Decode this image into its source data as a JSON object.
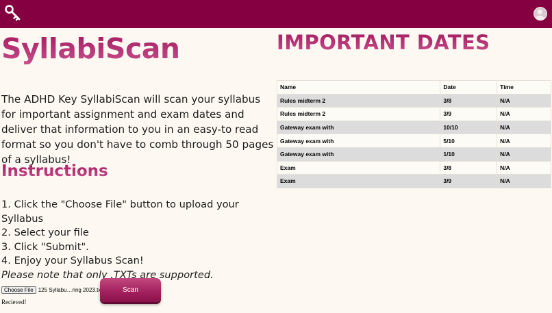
{
  "header": {
    "logo_icon": "key-icon",
    "avatar_icon": "user-avatar-icon",
    "brand_color": "#850041"
  },
  "hero": {
    "title": "SyllabiScan",
    "intro": "The ADHD Key SyllabiScan will scan your syllabus for important assignment and exam dates and deliver that information to you in an easy-to read format so you don't have to comb through 50 pages of a syllabus!"
  },
  "instructions": {
    "heading": "Instructions",
    "steps": [
      "1. Click the \"Choose File\" button to upload your Syllabus",
      "2. Select your file",
      "3. Click \"Submit\".",
      "4. Enjoy your Syllabus Scan!"
    ],
    "note": "Please note that only .TXTs are supported."
  },
  "upload": {
    "choose_label": "Choose File",
    "file_name": "125 Syllabu…ring 2023.txt",
    "scan_label": "Scan",
    "status": "Recieved!"
  },
  "dates": {
    "heading": "IMPORTANT DATES",
    "columns": [
      "Name",
      "Date",
      "Time"
    ],
    "rows": [
      [
        "Rules midterm 2",
        "3/8",
        "N/A"
      ],
      [
        "Rules midterm 2",
        "3/9",
        "N/A"
      ],
      [
        "Gateway exam with",
        "10/10",
        "N/A"
      ],
      [
        "Gateway exam with",
        "5/10",
        "N/A"
      ],
      [
        "Gateway exam with",
        "1/10",
        "N/A"
      ],
      [
        "Exam",
        "3/8",
        "N/A"
      ],
      [
        "Exam",
        "3/9",
        "N/A"
      ]
    ]
  }
}
